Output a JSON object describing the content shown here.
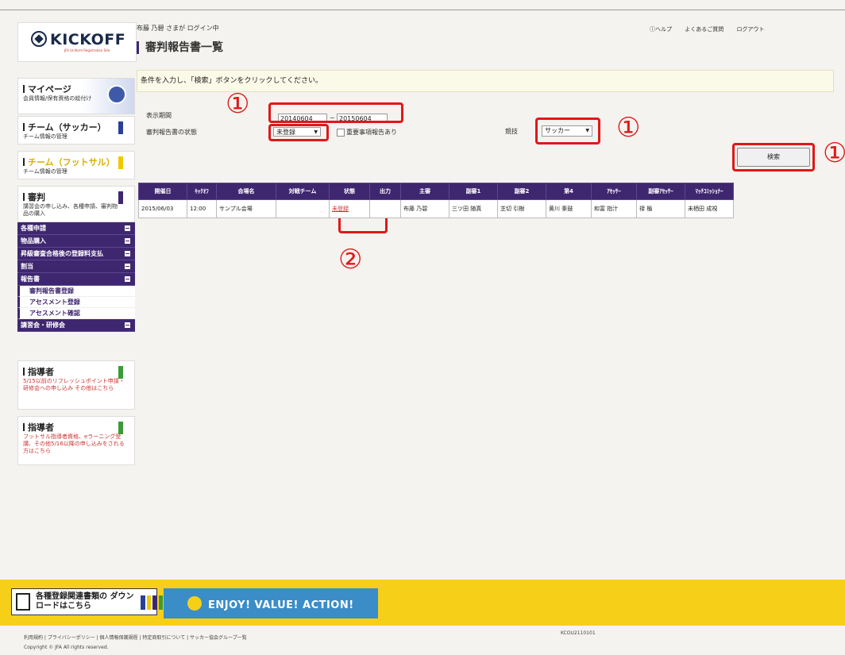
{
  "header": {
    "login_status": "布藤 乃碧 さまが ログイン中",
    "page_title": "審判報告書一覧",
    "links": [
      "ⓘヘルプ",
      "よくあるご質問",
      "ログアウト"
    ]
  },
  "logo": {
    "text": "KICKOFF",
    "sub": "JFA Uniform Registration Site"
  },
  "sidebar": {
    "boxes": [
      {
        "title": "マイページ",
        "sub": "会員情報/保有資格の絵付け"
      },
      {
        "title": "チーム（サッカー）",
        "sub": "チーム情報の管理"
      },
      {
        "title": "チーム（フットサル）",
        "sub": "チーム情報の管理"
      },
      {
        "title": "審判",
        "sub": "講習会の申し込み、各種申請、審判物品の購入"
      }
    ],
    "menu": [
      {
        "label": "各種申請",
        "type": "item"
      },
      {
        "label": "物品購入",
        "type": "item"
      },
      {
        "label": "昇級審査合格後の登録料支払",
        "type": "item"
      },
      {
        "label": "割当",
        "type": "item"
      },
      {
        "label": "報告書",
        "type": "item"
      },
      {
        "label": "審判報告書登録",
        "type": "sub"
      },
      {
        "label": "アセスメント登録",
        "type": "sub"
      },
      {
        "label": "アセスメント確認",
        "type": "sub"
      },
      {
        "label": "講習会・研修会",
        "type": "item"
      }
    ],
    "instructor_boxes": [
      {
        "title": "指導者",
        "sub": "5/15以前のリフレッシュポイント申請・研修会への申し込み その他はこちら"
      },
      {
        "title": "指導者",
        "sub": "フットサル指導者資格、eラーニング受講、その他5/16以降の申し込みをされる方はこちら"
      }
    ]
  },
  "instruction": "条件を入力し、「検索」ボタンをクリックしてください。",
  "form": {
    "period_label": "表示期間",
    "date_from": "20140604",
    "date_separator": "~",
    "date_to": "20150604",
    "status_label": "審判報告書の状態",
    "status_value": "未登録",
    "important_label": "重要事項報告あり",
    "sport_label": "競技",
    "sport_value": "サッカー",
    "search_label": "検索"
  },
  "annotations": {
    "one": "①",
    "two": "②"
  },
  "table": {
    "headers": [
      "開催日",
      "ｷｯｸｵﾌ",
      "会場名",
      "対戦チーム",
      "状態",
      "出力",
      "主審",
      "副審1",
      "副審2",
      "第4",
      "ｱｾｯｻｰ",
      "副審ｱｾｯｻｰ",
      "ﾏｯﾁｺﾐｯｼｮﾅｰ"
    ],
    "rows": [
      [
        "2015/06/03",
        "12:00",
        "サンプル会場",
        "",
        "未登録",
        "",
        "布藤 乃碧",
        "三ツ田 随真",
        "芝切 引樹",
        "黄川 秦鼓",
        "和富 指汁",
        "禄 楯",
        "未栖田 成視"
      ]
    ]
  },
  "footer": {
    "download_banner": "各種登録関連書類の ダウンロードはこちら",
    "enjoy_banner": "ENJOY! VALUE! ACTION!",
    "links": "利用規約 | プライバシーポリシー | 個人情報保護規程 | 特定商取引について | サッカー協会グループ一覧",
    "code": "KCOU2110101",
    "copyright": "Copyright © JFA All rights reserved."
  },
  "colors": {
    "accent": "#3f2770",
    "highlight": "#e01818",
    "footer": "#f6d018"
  }
}
